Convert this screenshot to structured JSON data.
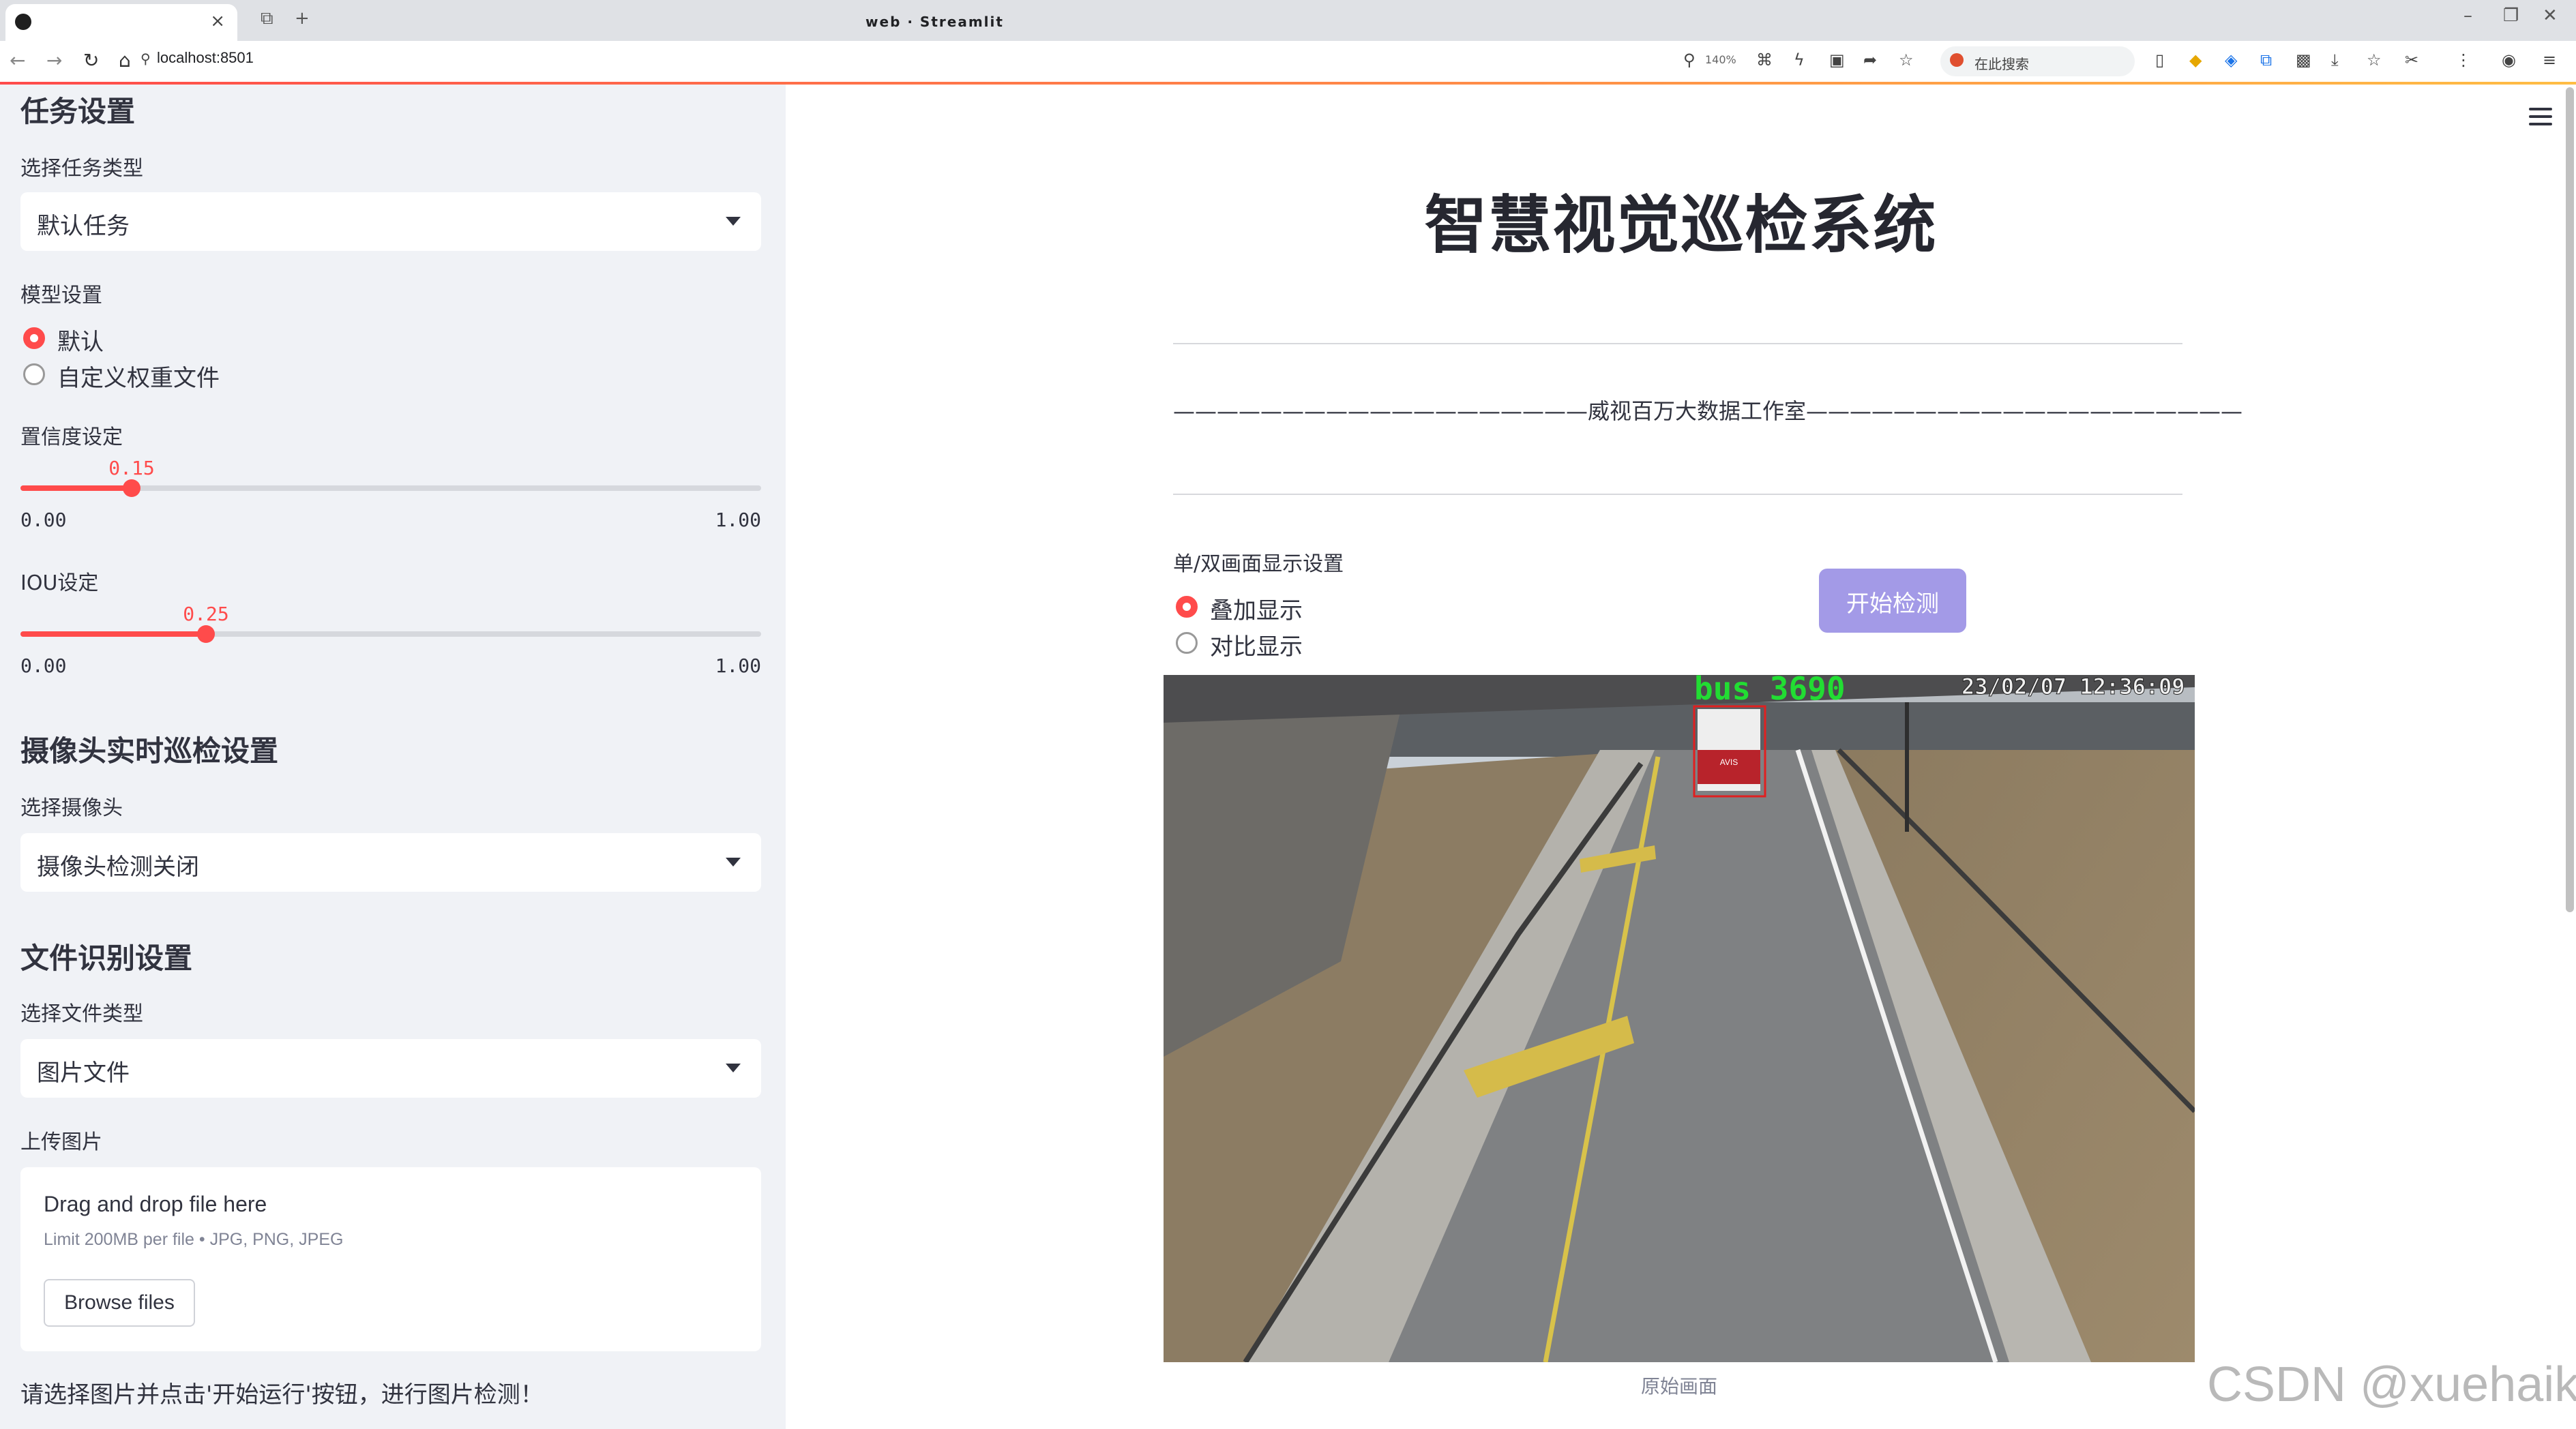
{
  "browser": {
    "tab_title": "web · Streamlit",
    "url": "localhost:8501",
    "zoom": "140%",
    "search_placeholder": "在此搜索"
  },
  "sidebar": {
    "task_section": "任务设置",
    "task_type_label": "选择任务类型",
    "task_type_value": "默认任务",
    "model_label": "模型设置",
    "model_options": [
      "默认",
      "自定义权重文件"
    ],
    "model_selected": "默认",
    "conf": {
      "label": "置信度设定",
      "value": "0.15",
      "min": "0.00",
      "max": "1.00",
      "fraction": 0.15
    },
    "iou": {
      "label": "IOU设定",
      "value": "0.25",
      "min": "0.00",
      "max": "1.00",
      "fraction": 0.25
    },
    "camera_section": "摄像头实时巡检设置",
    "camera_label": "选择摄像头",
    "camera_value": "摄像头检测关闭",
    "file_section": "文件识别设置",
    "file_type_label": "选择文件类型",
    "file_type_value": "图片文件",
    "upload_label": "上传图片",
    "upload_drag": "Drag and drop file here",
    "upload_limit": "Limit 200MB per file • JPG, PNG, JPEG",
    "browse_label": "Browse files",
    "hint": "请选择图片并点击'开始运行'按钮，进行图片检测！"
  },
  "main": {
    "title": "智慧视觉巡检系统",
    "studio_line": "———————————————————威视百万大数据工作室————————————————————",
    "display_label": "单/双画面显示设置",
    "display_options": [
      "叠加显示",
      "对比显示"
    ],
    "display_selected": "叠加显示",
    "run_button": "开始检测",
    "image": {
      "detection_label": "bus  3690",
      "timestamp": "23/02/07  12:36:09",
      "bus_sign": "AVIS"
    },
    "caption": "原始画面"
  },
  "watermark": "CSDN @xuehaikj",
  "colors": {
    "accent": "#ff4b4b",
    "run_button": "#a39ae7",
    "sidebar_bg": "#f0f2f6",
    "detect_box": "#e02020",
    "detect_text": "#22dd33"
  }
}
